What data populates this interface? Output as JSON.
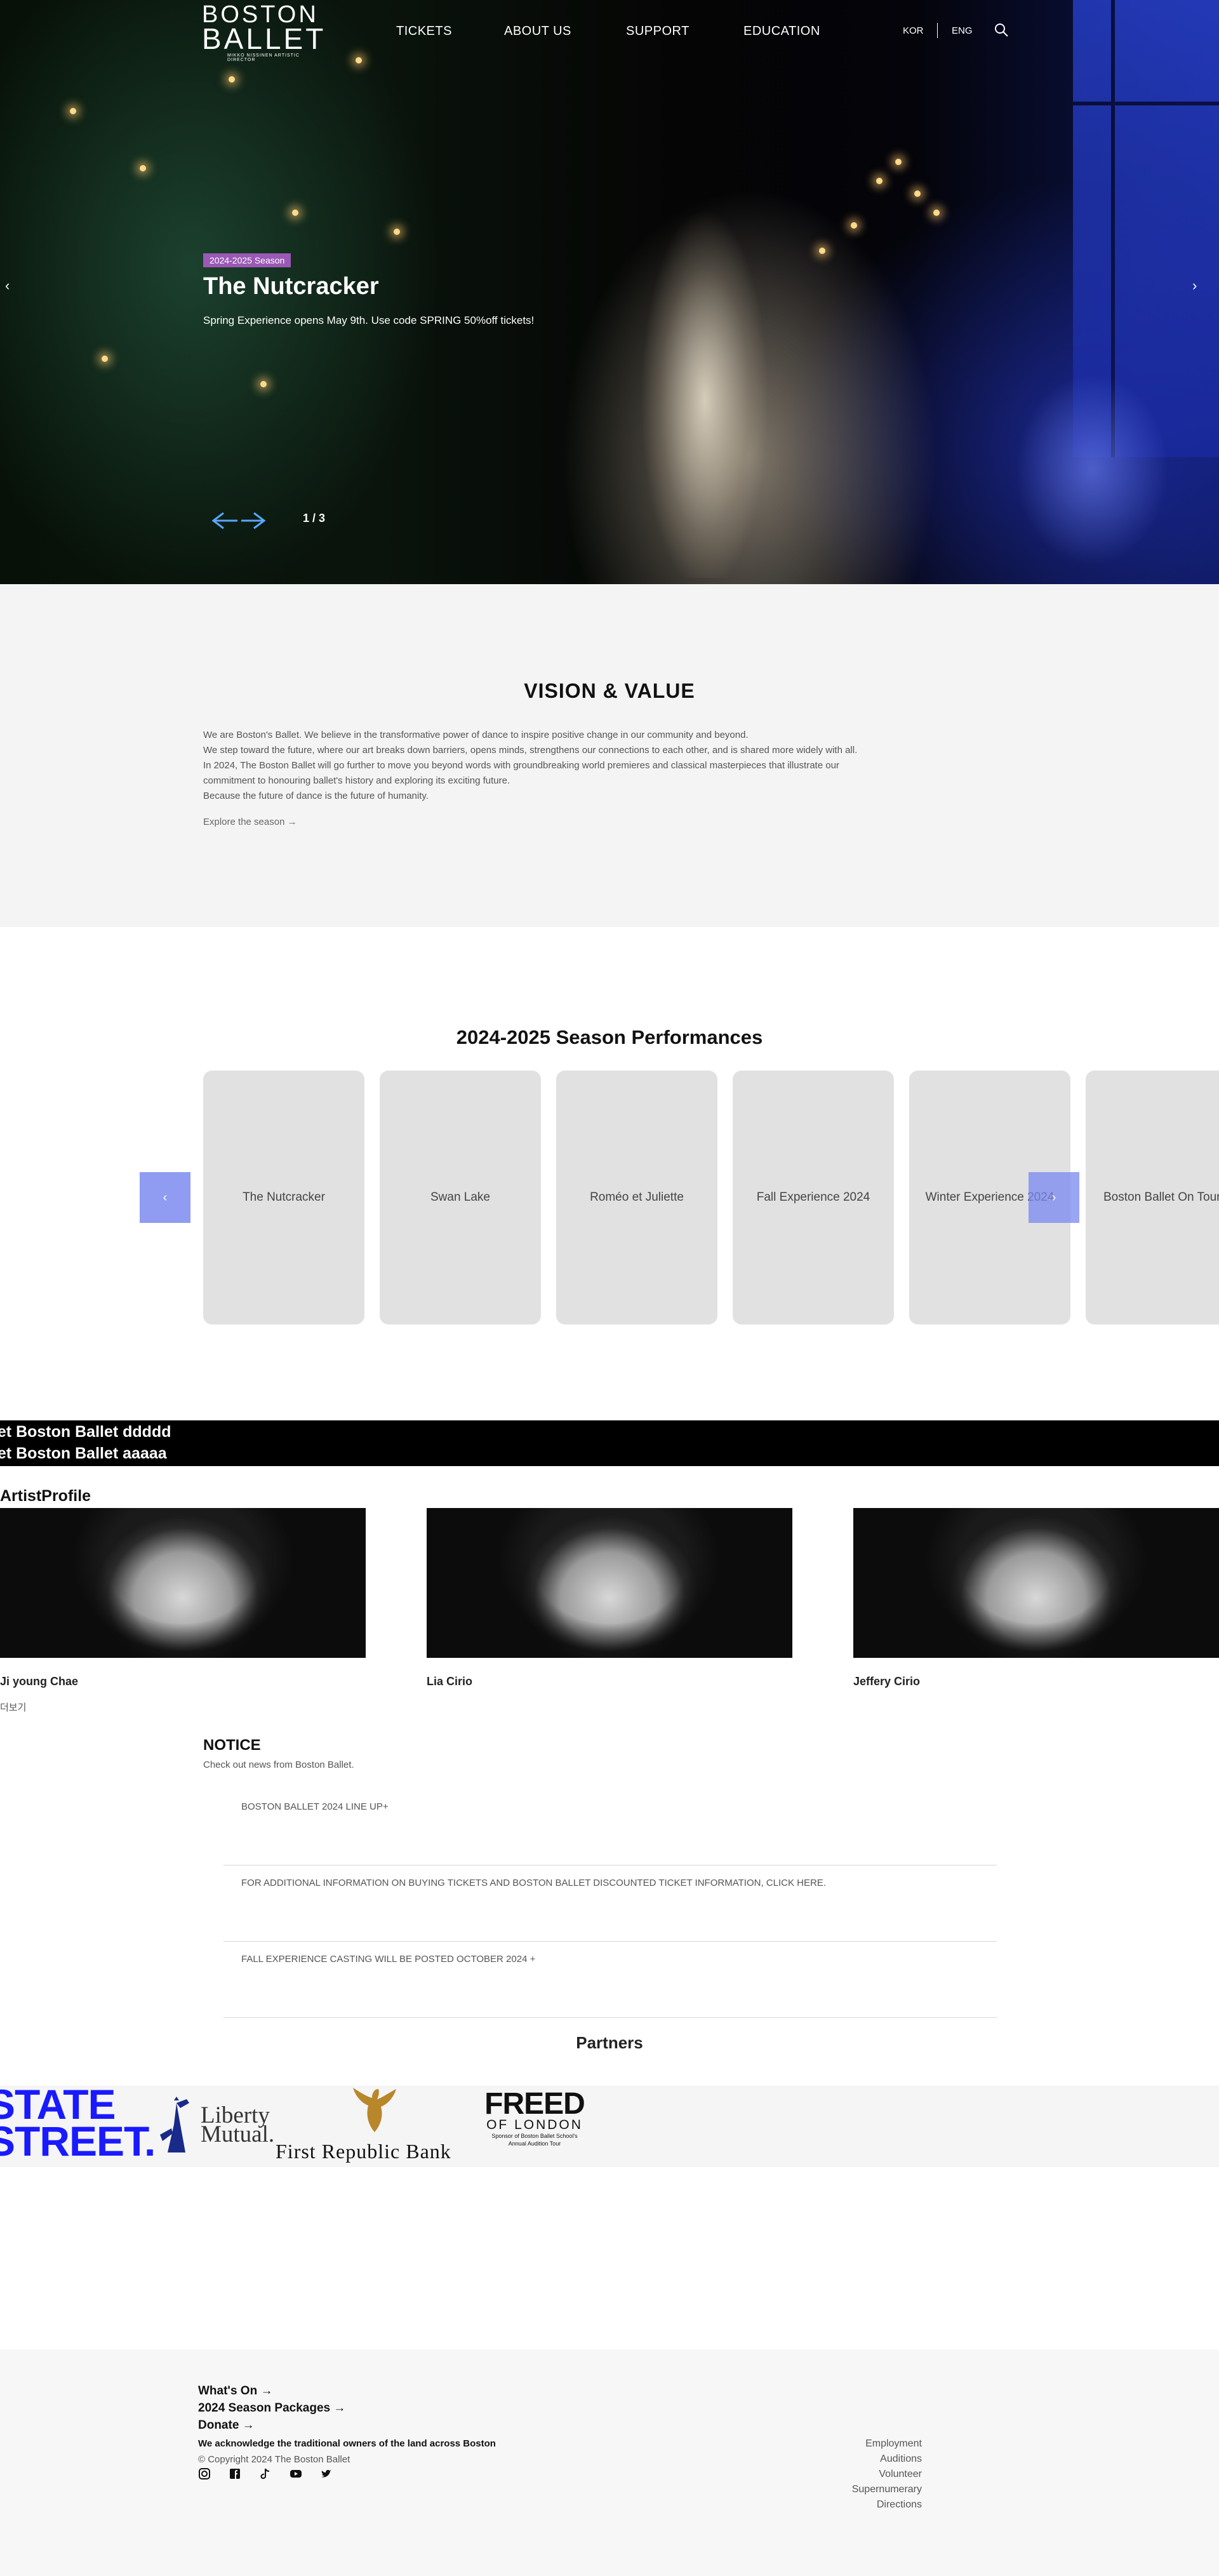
{
  "header": {
    "logo_line1": "BOSTON",
    "logo_line2": "BALLET",
    "logo_line3": "MIKKO NISSINEN  ARTISTIC DIRECTOR",
    "menu": [
      "TICKETS",
      "ABOUT US",
      "SUPPORT",
      "EDUCATION"
    ],
    "lang_kor": "KOR",
    "lang_eng": "ENG",
    "search_icon": "search-icon"
  },
  "hero": {
    "badge": "2024-2025 Season",
    "title": "The Nutcracker",
    "subtitle": "Spring Experience opens May 9th. Use code SPRING 50%off tickets!",
    "counter": "1 / 3",
    "prev_glyph": "‹",
    "next_glyph": "›"
  },
  "vision": {
    "title": "VISION & VALUE",
    "lines": [
      "We are Boston's Ballet. We believe in the transformative power of dance to inspire positive change in our community and beyond.",
      "We step toward the future, where our art breaks down barriers, opens minds, strengthens our connections to each other, and is shared more widely with all.",
      "In 2024, The Boston Ballet will go further to move you beyond words with groundbreaking world premieres and classical masterpieces that illustrate our",
      "commitment to honouring ballet's history and exploring its exciting future.",
      "Because the future of dance is the future of humanity."
    ],
    "explore": "Explore the season →"
  },
  "season": {
    "title": "2024-2025 Season Performances",
    "cards": [
      "The Nutcracker",
      "Swan Lake",
      "Roméo et Juliette",
      "Fall Experience 2024",
      "Winter Experience 2024",
      "Boston Ballet On Tour"
    ],
    "prev": "‹",
    "next": "›"
  },
  "marquee": {
    "line1": "llet Boston Ballet ddddd",
    "line2": "llet Boston Ballet aaaaa"
  },
  "artists": {
    "title": "ArtistProfile",
    "people": [
      {
        "name": "Ji young Chae"
      },
      {
        "name": "Lia Cirio"
      },
      {
        "name": "Jeffery Cirio"
      }
    ],
    "more": "더보기"
  },
  "notice": {
    "title": "NOTICE",
    "subtitle": "Check out news from Boston Ballet.",
    "items": [
      "BOSTON BALLET 2024 LINE UP+",
      "FOR ADDITIONAL INFORMATION ON BUYING TICKETS AND BOSTON BALLET DISCOUNTED TICKET INFORMATION, CLICK HERE.",
      "FALL EXPERIENCE CASTING WILL BE POSTED OCTOBER 2024 +"
    ]
  },
  "partners": {
    "title": "Partners",
    "state_street_1": "STATE",
    "state_street_2": "STREET.",
    "liberty_1": "Liberty",
    "liberty_2": "Mutual.",
    "first_republic": "First Republic Bank",
    "freed_1": "FREED",
    "freed_2": "OF LONDON",
    "freed_3": "Sponsor of Boston Ballet School's",
    "freed_4": "Annual Audition Tour"
  },
  "footer": {
    "links": [
      "What's On →",
      "2024 Season Packages →",
      "Donate →"
    ],
    "ack": "We acknowledge the traditional owners of the land across Boston",
    "copyright": "© Copyright 2024 The Boston Ballet",
    "social_icons": [
      "instagram-icon",
      "facebook-icon",
      "tiktok-icon",
      "youtube-icon",
      "twitter-icon"
    ],
    "right_links": [
      "Employment",
      "Auditions",
      "Volunteer",
      "Supernumerary",
      "Directions"
    ]
  }
}
